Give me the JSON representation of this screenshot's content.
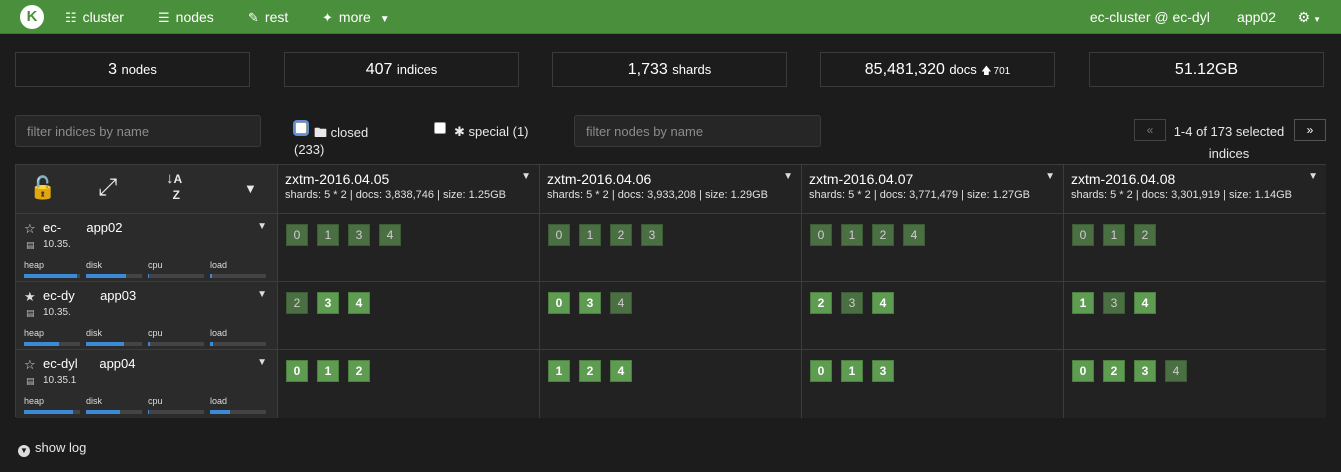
{
  "nav": {
    "logo": "K",
    "items": [
      {
        "icon": "sitemap",
        "label": "cluster"
      },
      {
        "icon": "list",
        "label": "nodes"
      },
      {
        "icon": "edit",
        "label": "rest"
      },
      {
        "icon": "wand",
        "label": "more"
      }
    ],
    "cluster_name": "ec-cluster @ ec-dyl       app02"
  },
  "stats": [
    {
      "value": "3",
      "unit": "nodes",
      "delta": ""
    },
    {
      "value": "407",
      "unit": "indices",
      "delta": ""
    },
    {
      "value": "1,733",
      "unit": "shards",
      "delta": ""
    },
    {
      "value": "85,481,320",
      "unit": "docs",
      "delta": "701"
    },
    {
      "value": "51.12GB",
      "unit": "",
      "delta": ""
    }
  ],
  "filters": {
    "indices_placeholder": "filter indices by name",
    "nodes_placeholder": "filter nodes by name",
    "closed_label": "closed",
    "closed_count": "(233)",
    "special_label": "special (1)"
  },
  "pager": {
    "prev": "«",
    "next": "»",
    "text": "1-4 of 173 selected indices"
  },
  "indices": [
    {
      "name": "zxtm-2016.04.05",
      "meta": "shards: 5 * 2 | docs: 3,838,746 | size: 1.25GB"
    },
    {
      "name": "zxtm-2016.04.06",
      "meta": "shards: 5 * 2 | docs: 3,933,208 | size: 1.29GB"
    },
    {
      "name": "zxtm-2016.04.07",
      "meta": "shards: 5 * 2 | docs: 3,771,479 | size: 1.27GB"
    },
    {
      "name": "zxtm-2016.04.08",
      "meta": "shards: 5 * 2 | docs: 3,301,919 | size: 1.14GB"
    }
  ],
  "nodes": [
    {
      "name": "ec-       app02",
      "ip": "10.35.     ",
      "master": false,
      "metrics": {
        "heap": 0.95,
        "disk": 0.72,
        "cpu": 0.02,
        "load": 0.03
      },
      "shards": [
        [
          {
            "n": "0",
            "primary": false
          },
          {
            "n": "1",
            "primary": false
          },
          {
            "n": "3",
            "primary": false
          },
          {
            "n": "4",
            "primary": false
          }
        ],
        [
          {
            "n": "0",
            "primary": false
          },
          {
            "n": "1",
            "primary": false
          },
          {
            "n": "2",
            "primary": false
          },
          {
            "n": "3",
            "primary": false
          }
        ],
        [
          {
            "n": "0",
            "primary": false
          },
          {
            "n": "1",
            "primary": false
          },
          {
            "n": "2",
            "primary": false
          },
          {
            "n": "4",
            "primary": false
          }
        ],
        [
          {
            "n": "0",
            "primary": false
          },
          {
            "n": "1",
            "primary": false
          },
          {
            "n": "2",
            "primary": false
          }
        ]
      ]
    },
    {
      "name": "ec-dy       app03",
      "ip": "10.35.       ",
      "master": true,
      "metrics": {
        "heap": 0.62,
        "disk": 0.68,
        "cpu": 0.03,
        "load": 0.05
      },
      "shards": [
        [
          {
            "n": "2",
            "primary": false
          },
          {
            "n": "3",
            "primary": true
          },
          {
            "n": "4",
            "primary": true
          }
        ],
        [
          {
            "n": "0",
            "primary": true
          },
          {
            "n": "3",
            "primary": true
          },
          {
            "n": "4",
            "primary": false
          }
        ],
        [
          {
            "n": "2",
            "primary": true
          },
          {
            "n": "3",
            "primary": false
          },
          {
            "n": "4",
            "primary": true
          }
        ],
        [
          {
            "n": "1",
            "primary": true
          },
          {
            "n": "3",
            "primary": false
          },
          {
            "n": "4",
            "primary": true
          }
        ]
      ]
    },
    {
      "name": "ec-dyl      app04",
      "ip": "10.35.1      ",
      "master": false,
      "metrics": {
        "heap": 0.88,
        "disk": 0.6,
        "cpu": 0.02,
        "load": 0.35
      },
      "shards": [
        [
          {
            "n": "0",
            "primary": true
          },
          {
            "n": "1",
            "primary": true
          },
          {
            "n": "2",
            "primary": true
          }
        ],
        [
          {
            "n": "1",
            "primary": true
          },
          {
            "n": "2",
            "primary": true
          },
          {
            "n": "4",
            "primary": true
          }
        ],
        [
          {
            "n": "0",
            "primary": true
          },
          {
            "n": "1",
            "primary": true
          },
          {
            "n": "3",
            "primary": true
          }
        ],
        [
          {
            "n": "0",
            "primary": true
          },
          {
            "n": "2",
            "primary": true
          },
          {
            "n": "3",
            "primary": true
          },
          {
            "n": "4",
            "primary": false
          }
        ]
      ]
    }
  ],
  "metric_labels": [
    "heap",
    "disk",
    "cpu",
    "load"
  ],
  "footer": {
    "show_log": "show log"
  }
}
